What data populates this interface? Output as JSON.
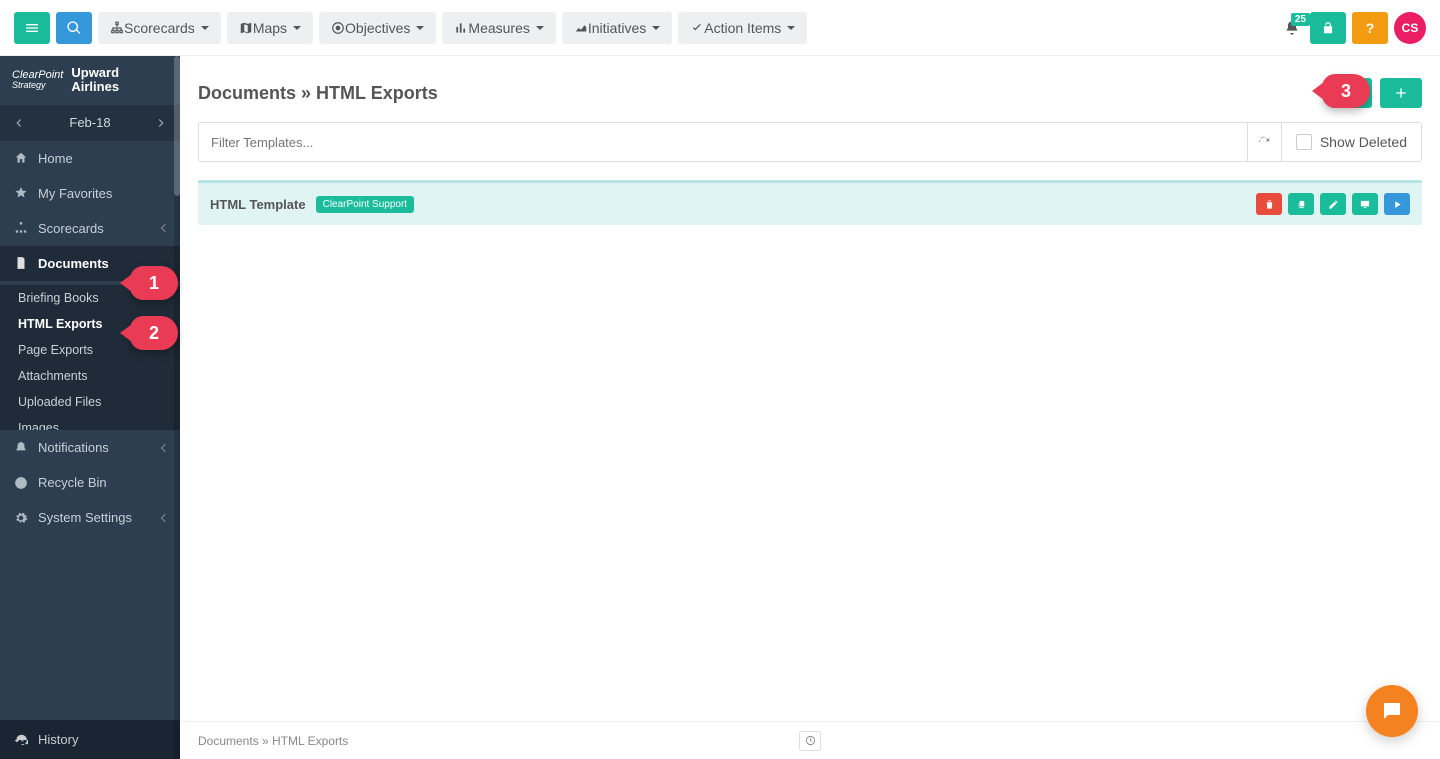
{
  "topnav": {
    "scorecards": "Scorecards",
    "maps": "Maps",
    "objectives": "Objectives",
    "measures": "Measures",
    "initiatives": "Initiatives",
    "action_items": "Action Items",
    "notif_count": "25",
    "avatar": "CS"
  },
  "brand": {
    "logo_top": "ClearPoint",
    "logo_bottom": "Strategy",
    "name": "Upward Airlines"
  },
  "period": "Feb-18",
  "sidebar": {
    "home": "Home",
    "favorites": "My Favorites",
    "scorecards": "Scorecards",
    "documents": "Documents",
    "docs_children": {
      "briefing": "Briefing Books",
      "html_exports": "HTML Exports",
      "page_exports": "Page Exports",
      "attachments": "Attachments",
      "uploaded": "Uploaded Files",
      "images": "Images"
    },
    "notifications": "Notifications",
    "recycle": "Recycle Bin",
    "system": "System Settings",
    "history": "History"
  },
  "page": {
    "breadcrumb": "Documents » HTML Exports",
    "filter_placeholder": "Filter Templates...",
    "show_deleted": "Show Deleted"
  },
  "rows": [
    {
      "title": "HTML Template",
      "pill": "ClearPoint Support"
    }
  ],
  "footer": {
    "breadcrumb": "Documents » HTML Exports"
  },
  "callouts": {
    "c1": "1",
    "c2": "2",
    "c3": "3"
  },
  "colors": {
    "teal": "#1abc9c",
    "blue": "#3498db",
    "red": "#e74c3c",
    "orange": "#f39c12"
  }
}
